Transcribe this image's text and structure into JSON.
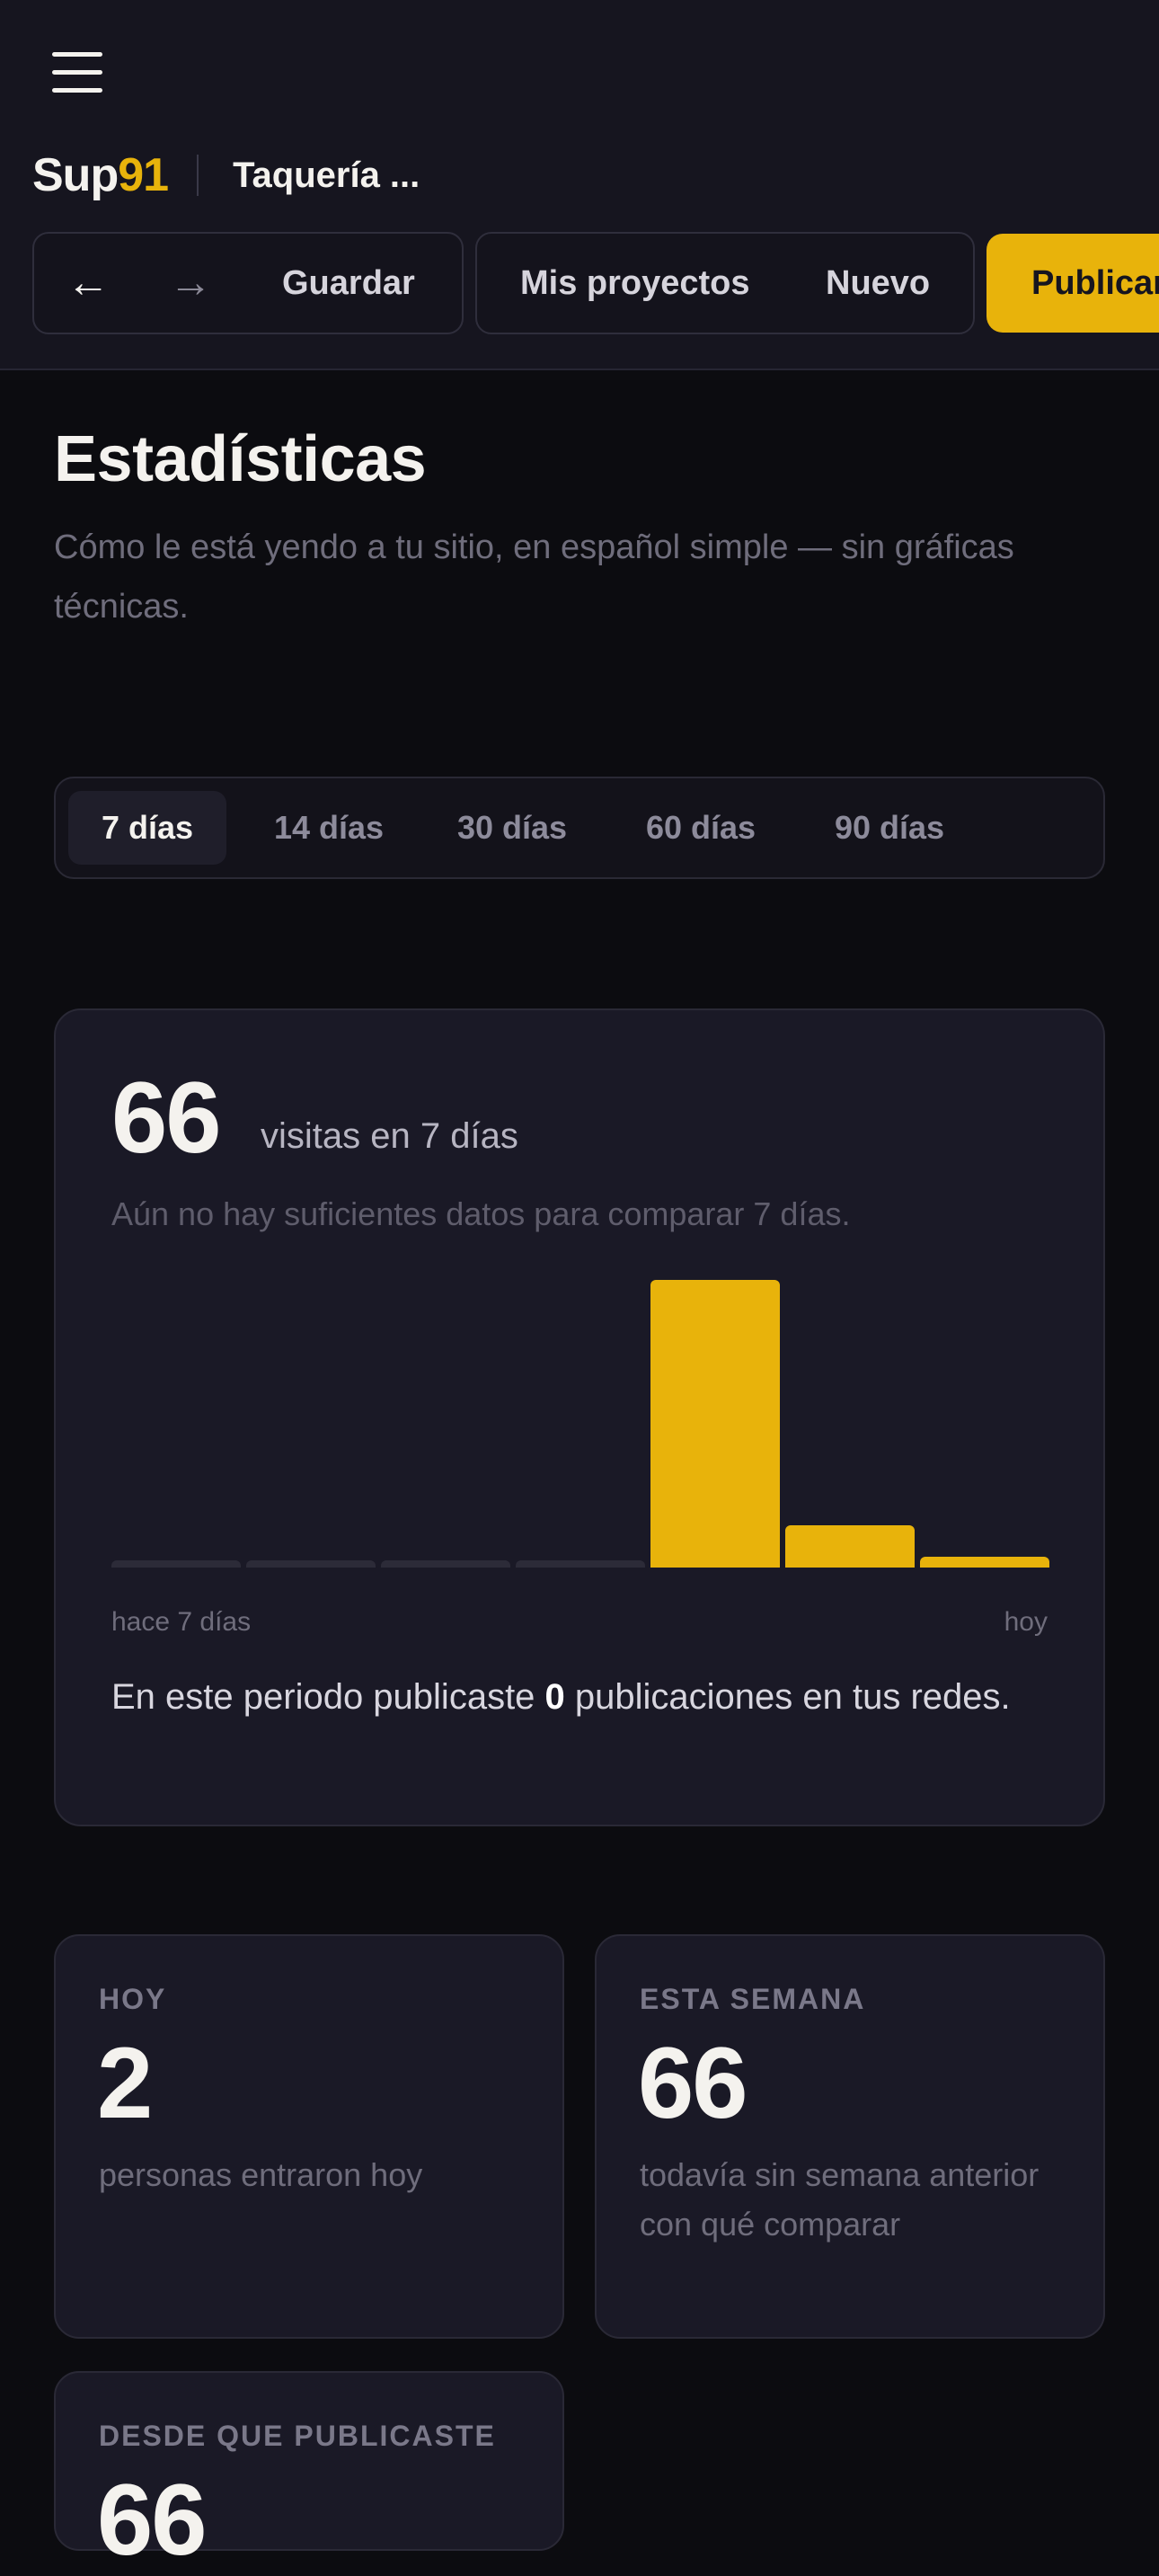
{
  "header": {
    "brand_text": "Sup",
    "brand_number": "91",
    "site_name": "Taquería ...",
    "back_arrow": "←",
    "forward_arrow": "→",
    "save_label": "Guardar",
    "projects_label": "Mis proyectos",
    "new_label": "Nuevo",
    "publish_label": "Publicar"
  },
  "page": {
    "title": "Estadísticas",
    "subtitle": "Cómo le está yendo a tu sitio, en español simple — sin gráficas técnicas."
  },
  "range_tabs": [
    {
      "label": "7 días",
      "active": true
    },
    {
      "label": "14 días",
      "active": false
    },
    {
      "label": "30 días",
      "active": false
    },
    {
      "label": "60 días",
      "active": false
    },
    {
      "label": "90 días",
      "active": false
    }
  ],
  "summary": {
    "visits": "66",
    "visits_label": "visitas en 7 días",
    "compare_note": "Aún no hay suficientes datos para comparar 7 días.",
    "axis_start": "hace 7 días",
    "axis_end": "hoy",
    "posts_prefix": "En este periodo publicaste ",
    "posts_count": "0",
    "posts_suffix": " publicaciones en tus redes."
  },
  "chart_data": {
    "type": "bar",
    "categories": [
      "hace 7 días",
      "",
      "",
      "",
      "",
      "",
      "hoy"
    ],
    "values": [
      0,
      0,
      0,
      0,
      55,
      8,
      2
    ],
    "xlabel": "",
    "ylabel": "",
    "ylim": [
      0,
      55
    ],
    "grid": false
  },
  "stats": [
    {
      "label": "HOY",
      "value": "2",
      "desc": "personas entraron hoy"
    },
    {
      "label": "ESTA SEMANA",
      "value": "66",
      "desc": "todavía sin semana anterior con qué comparar"
    },
    {
      "label": "DESDE QUE PUBLICASTE",
      "value": "66",
      "desc": ""
    }
  ],
  "colors": {
    "accent": "#e8b30b",
    "background": "#0c0c10",
    "card": "#1a1926"
  },
  "icons": {
    "menu": "hamburger-icon",
    "back": "arrow-left-icon",
    "forward": "arrow-right-icon"
  }
}
